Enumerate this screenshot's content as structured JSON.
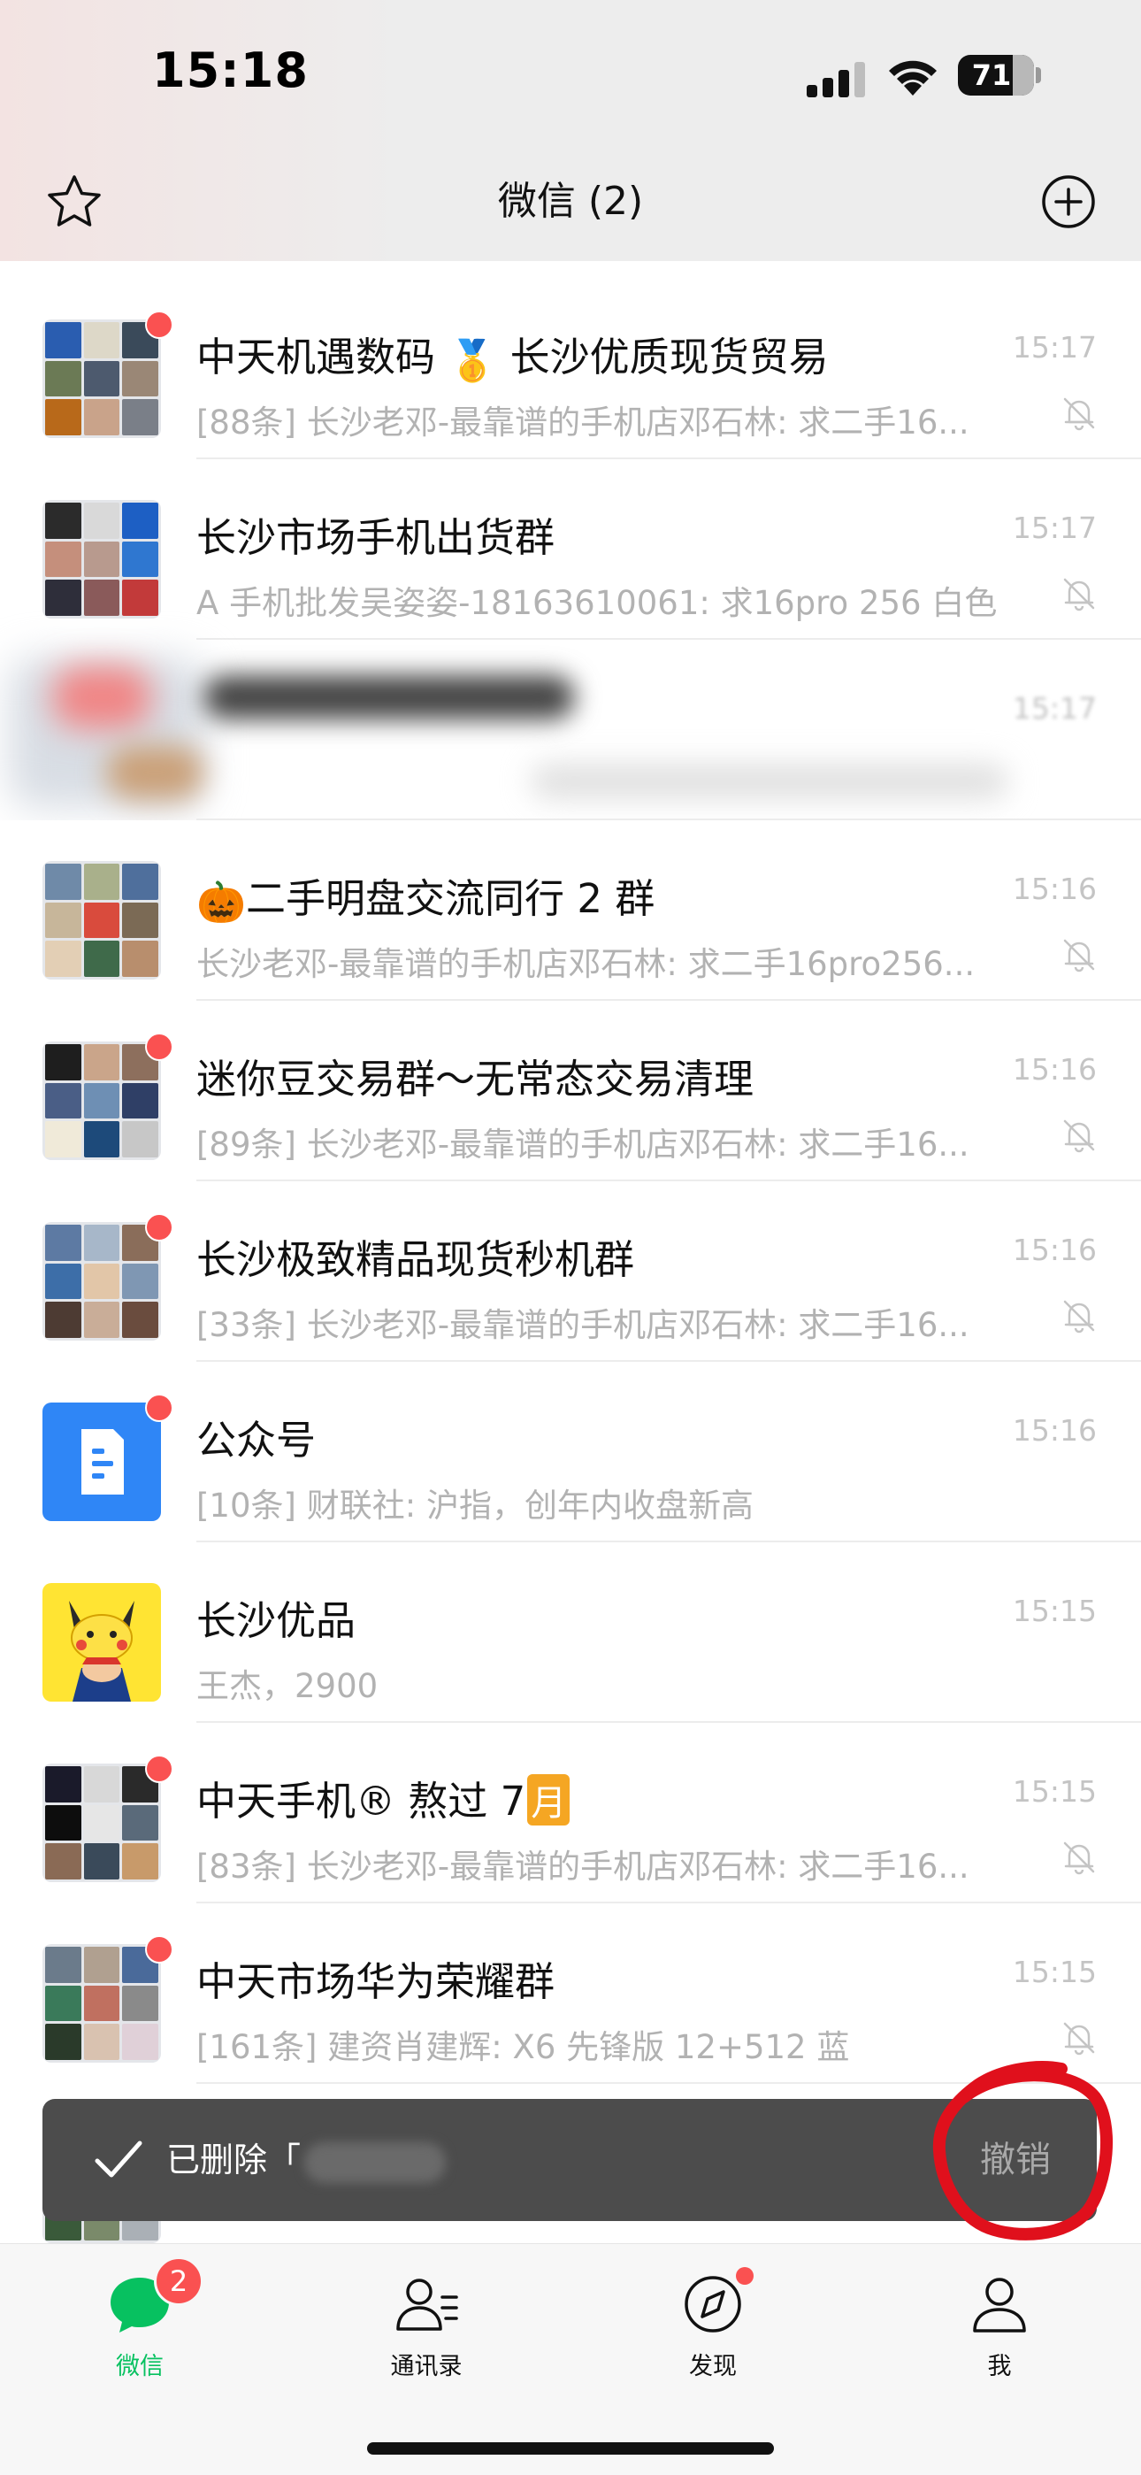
{
  "status_bar": {
    "time": "15:18",
    "battery_level": "71",
    "battery_fraction": 0.71
  },
  "nav": {
    "title": "微信 (2)"
  },
  "chats": [
    {
      "title": "中天机遇数码",
      "title_suffix": "长沙优质现货贸易",
      "title_emoji": "🥇",
      "preview": "[88条] 长沙老邓-最靠谱的手机店邓石林: 求二手16...",
      "time": "15:17",
      "unread_dot": true,
      "muted": true
    },
    {
      "title": "长沙市场手机出货群",
      "preview": "A 手机批发吴姿姿-18163610061:  求16pro 256 白色",
      "time": "15:17",
      "unread_dot": false,
      "muted": true
    },
    {
      "title": "",
      "preview": "",
      "time": "15:17",
      "blurred": true
    },
    {
      "title_emoji": "🎃",
      "title": "二手明盘交流同行 2 群",
      "preview": "长沙老邓-最靠谱的手机店邓石林: 求二手16pro256...",
      "time": "15:16",
      "unread_dot": false,
      "muted": true
    },
    {
      "title": "迷你豆交易群～无常态交易清理",
      "preview": "[89条] 长沙老邓-最靠谱的手机店邓石林: 求二手16...",
      "time": "15:16",
      "unread_dot": true,
      "muted": true
    },
    {
      "title": "长沙极致精品现货秒机群",
      "preview": "[33条] 长沙老邓-最靠谱的手机店邓石林: 求二手16...",
      "time": "15:16",
      "unread_dot": true,
      "muted": true
    },
    {
      "title": "公众号",
      "preview": "[10条] 财联社: 沪指，创年内收盘新高",
      "time": "15:16",
      "unread_dot": true,
      "muted": false
    },
    {
      "title": "长沙优品",
      "preview": "王杰，2900",
      "time": "15:15",
      "unread_dot": false,
      "muted": false
    },
    {
      "title": "中天手机® 熬过 7",
      "title_badge": "月",
      "preview": "[83条] 长沙老邓-最靠谱的手机店邓石林: 求二手16...",
      "time": "15:15",
      "unread_dot": true,
      "muted": true
    },
    {
      "title": "中天市场华为荣耀群",
      "preview": "[161条] 建资肖建辉: X6  先锋版  12+512 蓝",
      "time": "15:15",
      "unread_dot": true,
      "muted": true
    }
  ],
  "toast": {
    "text": "已删除「",
    "undo_label": "撤销"
  },
  "tabs": [
    {
      "label": "微信",
      "badge": "2",
      "active": true,
      "icon": "chat-bubble-icon"
    },
    {
      "label": "通讯录",
      "active": false,
      "icon": "contacts-icon"
    },
    {
      "label": "发现",
      "active": false,
      "dot": true,
      "icon": "compass-icon"
    },
    {
      "label": "我",
      "active": false,
      "icon": "person-icon"
    }
  ],
  "colors": {
    "accent_green": "#07c160",
    "badge_red": "#fa5151",
    "toast_bg": "#4c4c4c",
    "annotation_red": "#e0101c",
    "official_account_blue": "#2f86f6",
    "pokemon_yellow": "#ffe433"
  }
}
